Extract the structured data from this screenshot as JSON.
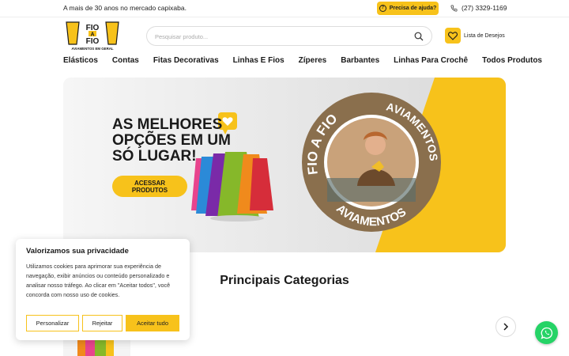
{
  "topbar": {
    "tagline": "A mais de 30 anos no mercado capixaba.",
    "help_label": "Precisa de ajuda?",
    "phone": "(27) 3329-1169"
  },
  "logo": {
    "line1": "FIO",
    "line2": "A",
    "line3": "FIO",
    "subtitle": "AVIAMENTOS EM GERAL"
  },
  "search": {
    "placeholder": "Pesquisar produto..."
  },
  "wishlist": {
    "label": "Lista de Desejos"
  },
  "nav": {
    "items": [
      {
        "label": "Elásticos"
      },
      {
        "label": "Contas"
      },
      {
        "label": "Fitas Decorativas"
      },
      {
        "label": "Linhas E Fios"
      },
      {
        "label": "Zíperes"
      },
      {
        "label": "Barbantes"
      },
      {
        "label": "Linhas Para Crochê"
      },
      {
        "label": "Todos Produtos"
      }
    ]
  },
  "banner": {
    "headline_1": "AS MELHORES",
    "headline_2": "OPÇÕES EM UM",
    "headline_3": "SÓ LUGAR!",
    "cta_1": "ACESSAR",
    "cta_2": "PRODUTOS",
    "arc_top": "FIO A FIO",
    "arc_right": "AVIAMENTOS",
    "arc_bottom": "AVIAMENTOS"
  },
  "categories": {
    "title": "Principais Categorias"
  },
  "cookie": {
    "title": "Valorizamos sua privacidade",
    "body": "Utilizamos cookies para aprimorar sua experiência de navegação, exibir anúncios ou conteúdo personalizado e analisar nosso tráfego. Ao clicar em \"Aceitar todos\", você concorda com nosso uso de cookies.",
    "customize": "Personalizar",
    "reject": "Rejeitar",
    "accept": "Aceitar tudo"
  },
  "colors": {
    "accent": "#f7c21b",
    "whatsapp": "#25d366",
    "circle": "#8a6f4d"
  }
}
